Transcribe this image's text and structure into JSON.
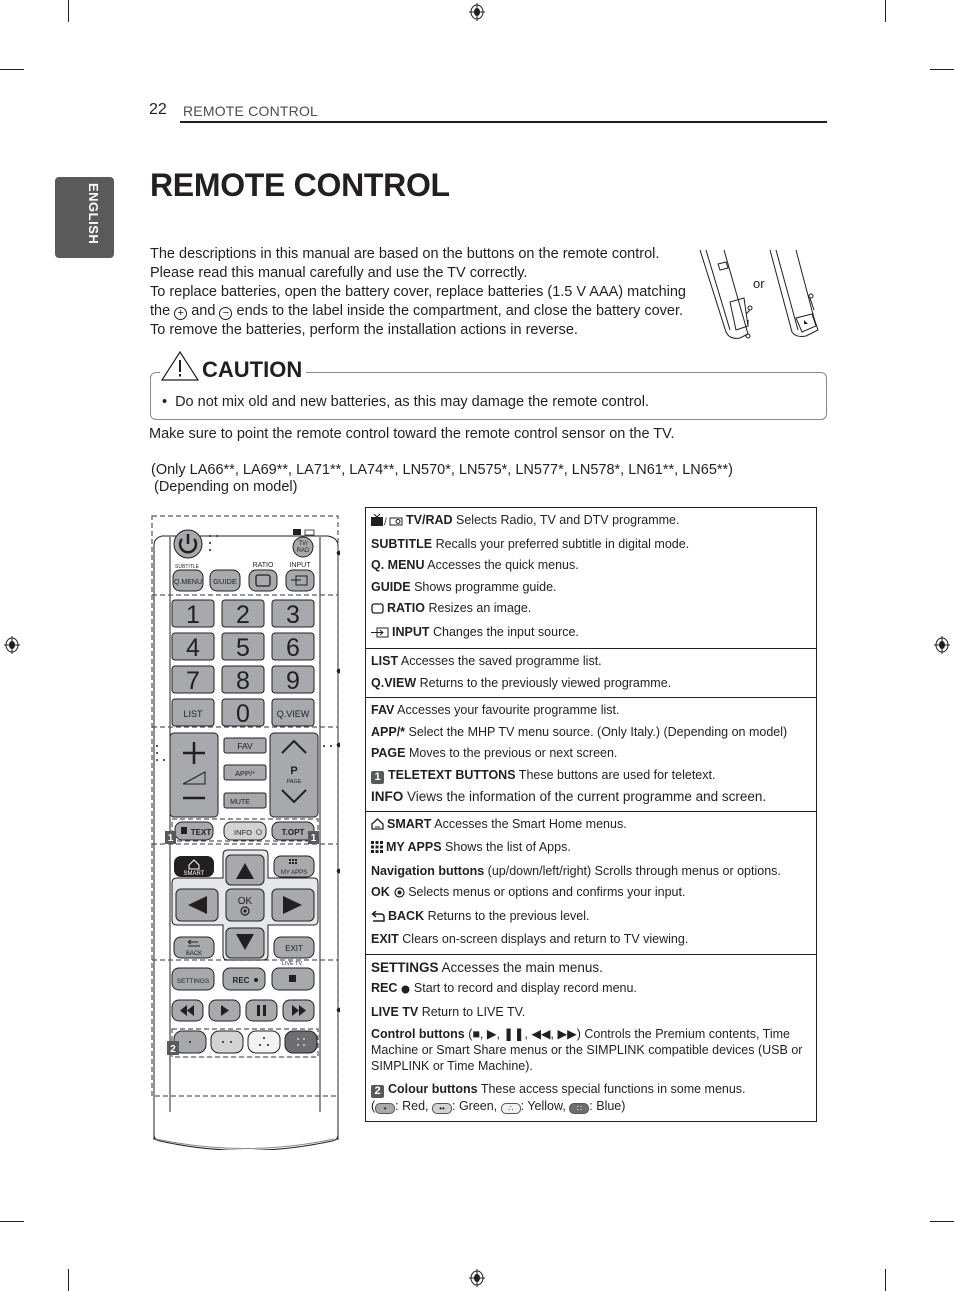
{
  "header": {
    "page_number": "22",
    "running_head": "REMOTE CONTROL"
  },
  "language_tab": "ENGLISH",
  "title": "REMOTE CONTROL",
  "intro": {
    "lines": [
      "The descriptions in this manual are based on the buttons on the remote control.",
      "Please read this manual carefully and use the TV correctly.",
      "To replace batteries, open the battery cover, replace batteries (1.5 V AAA) matching"
    ],
    "line4_pre": "the",
    "line4_mid": "and",
    "line4_post": "ends to the label inside the compartment, and close the battery cover.",
    "line5": "To remove the batteries, perform the installation actions in reverse.",
    "plus_symbol": "+",
    "minus_symbol": "−"
  },
  "battery_figure": {
    "or_label": "or"
  },
  "caution": {
    "heading": "CAUTION",
    "items": [
      "Do not mix old and new batteries, as this may damage the remote control."
    ]
  },
  "aim_note": "Make sure to point the remote control toward the remote control sensor on the TV.",
  "models": {
    "line1": "(Only  LA66**, LA69**, LA71**, LA74**, LN570*, LN575*, LN577*, LN578*, LN61**, LN65**)",
    "line2": "(Depending on model)"
  },
  "remote": {
    "labels": {
      "subtitle": "SUBTITLE",
      "ratio": "RATIO",
      "input": "INPUT",
      "tvrad": "TV/\nRAD",
      "qmenu": "Q.MENU",
      "guide": "GUIDE",
      "digits": [
        "1",
        "2",
        "3",
        "4",
        "5",
        "6",
        "7",
        "8",
        "9"
      ],
      "list": "LIST",
      "zero": "0",
      "qview": "Q.VIEW",
      "fav": "FAV",
      "app": "APP/*",
      "mute": "MUTE",
      "page_p": "P",
      "page": "PAGE",
      "text": "TEXT",
      "info": "INFO",
      "topt": "T.OPT",
      "smart": "SMART",
      "myapps": "MY APPS",
      "ok": "OK",
      "back": "BACK",
      "exit": "EXIT",
      "livetv": "LIVE TV",
      "settings": "SETTINGS",
      "rec": "REC",
      "badge1": "1",
      "badge2": "2"
    },
    "colour_buttons": [
      {
        "name": "red",
        "fill": "#a7a9ac"
      },
      {
        "name": "green",
        "fill": "#d1d3d4"
      },
      {
        "name": "yellow",
        "fill": "#f1f2f2"
      },
      {
        "name": "blue",
        "fill": "#6d6e71"
      }
    ]
  },
  "descriptions": [
    {
      "items": [
        {
          "icon": "tv-radio-icon",
          "key": "TV/RAD",
          "text": " Selects Radio, TV and DTV programme."
        },
        {
          "key": "SUBTITLE",
          "text": " Recalls your preferred subtitle in digital mode."
        },
        {
          "key": "Q. MENU",
          "text": " Accesses the quick menus."
        },
        {
          "key": "GUIDE",
          "text": " Shows programme guide."
        },
        {
          "icon": "ratio-icon",
          "key": "RATIO",
          "text": " Resizes an image."
        },
        {
          "icon": "input-icon",
          "key": "INPUT",
          "text": " Changes the input source."
        }
      ]
    },
    {
      "items": [
        {
          "key": "LIST",
          "text": " Accesses the saved  programme list."
        },
        {
          "key": "Q.VIEW",
          "text": " Returns to the previously viewed programme."
        }
      ]
    },
    {
      "items": [
        {
          "key": "FAV",
          "text": " Accesses your favourite programme list."
        },
        {
          "key": "APP/*",
          "text": " Select the MHP TV menu source. (Only Italy.) (Depending on model)"
        },
        {
          "key": "PAGE",
          "text": " Moves to the previous or next screen."
        },
        {
          "badge": "1",
          "key": "TELETEXT BUTTONS",
          "text": " These buttons are used for teletext."
        },
        {
          "key": "INFO",
          "text": " Views the information of the current programme and screen.",
          "big": true
        }
      ]
    },
    {
      "items": [
        {
          "icon": "home-icon",
          "key": "SMART",
          "text": " Accesses the Smart Home menus."
        },
        {
          "icon": "apps-grid-icon",
          "key": "MY APPS",
          "text": " Shows the list of Apps."
        },
        {
          "key": "Navigation buttons",
          "text": " (up/down/left/right) Scrolls through menus or options."
        },
        {
          "key": "OK",
          "icon_after": "ok-target-icon",
          "text": " Selects menus or options and confirms your input."
        },
        {
          "icon": "back-arrow-icon",
          "key": "BACK",
          "text": " Returns to the previous level."
        },
        {
          "key": "EXIT",
          "text": " Clears on-screen displays and return to TV viewing."
        }
      ]
    },
    {
      "items": [
        {
          "key": "SETTINGS",
          "text": " Accesses the main menus.",
          "big": true
        },
        {
          "key": "REC",
          "icon_after": "record-dot-icon",
          "text": " Start to record and display record menu."
        },
        {
          "key": "LIVE TV",
          "text": " Return to LIVE TV."
        },
        {
          "key": "Control buttons",
          "text": " (■, ▶, ❚❚, ◀◀, ▶▶) Controls the Premium contents, Time Machine or Smart Share menus or the SIMPLINK compatible devices (USB or SIMPLINK or Time Machine).",
          "wrap": true
        },
        {
          "badge": "2",
          "key": "Colour buttons",
          "text": " These access special functions in some menus.",
          "wrap": true,
          "colour_legend": true
        }
      ]
    }
  ],
  "colour_legend": {
    "open": "(",
    "red": ": Red, ",
    "green": ": Green, ",
    "yellow": ": Yellow, ",
    "blue": ": Blue)"
  }
}
